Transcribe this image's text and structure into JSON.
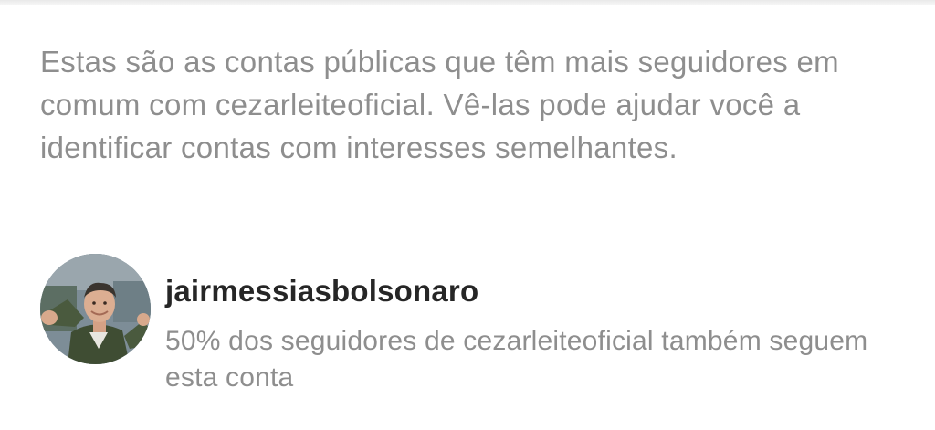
{
  "description": "Estas são as contas públicas que têm mais seguidores em comum com cezarleiteoficial. Vê-las pode ajudar você a identificar contas com interesses semelhantes.",
  "account": {
    "username": "jairmessiasbolsonaro",
    "mutual_info": "50% dos seguidores de cezarleiteoficial também seguem esta conta",
    "avatar_icon": "profile-photo-avatar"
  },
  "colors": {
    "primary_text": "#262626",
    "secondary_text": "#8e8e8e",
    "background": "#ffffff"
  }
}
